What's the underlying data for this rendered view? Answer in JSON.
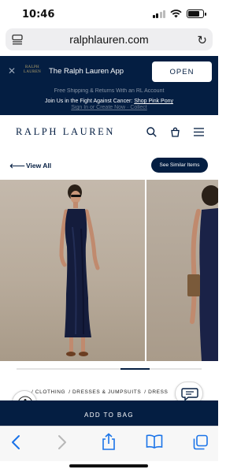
{
  "status_bar": {
    "time": "10:46"
  },
  "browser": {
    "url": "ralphlauren.com"
  },
  "app_banner": {
    "logo_text": "RALPH LAUREN",
    "title": "The Ralph Lauren App",
    "open_label": "OPEN"
  },
  "promo": {
    "line1": "Free Shipping & Returns With an RL Account",
    "line2_prefix": "Join Us in the Fight Against Cancer:",
    "line2_link": "Shop Pink Pony",
    "line3": "Sign In or Create Now · Collect"
  },
  "header": {
    "wordmark": "RALPH LAUREN"
  },
  "nav": {
    "view_all_label": "View All",
    "similar_label": "See Similar Items"
  },
  "gallery": {
    "image_count": 2,
    "progress_start_fraction": 0.56,
    "progress_end_fraction": 0.72
  },
  "breadcrumb": {
    "items": [
      "/ CLOTHING",
      "/ DRESSES & JUMPSUITS",
      "/ DRESS"
    ]
  },
  "cta": {
    "add_to_bag_label": "ADD TO BAG"
  },
  "colors": {
    "navy": "#041e42",
    "gold": "#b7a36a"
  },
  "icons": [
    "tabs-menu-icon",
    "reload-icon",
    "close-icon",
    "search-icon",
    "bag-icon",
    "hamburger-icon",
    "arrow-left-icon",
    "accessibility-icon",
    "chat-icon",
    "back-icon",
    "forward-icon",
    "share-icon",
    "bookmarks-icon",
    "tabs-icon"
  ]
}
